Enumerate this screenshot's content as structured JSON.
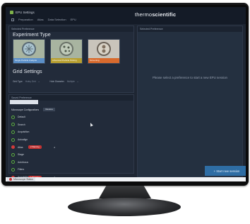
{
  "app": {
    "title": "EPU Settings",
    "brand_light": "thermo",
    "brand_bold": "scientific"
  },
  "menu": [
    "Preparation",
    "Atlas",
    "Data Selection",
    "EPU"
  ],
  "left_top": {
    "header": "Selected Preference",
    "experiment_type_title": "Experiment Type",
    "cards": [
      {
        "label": "Single Particle Analysis",
        "color": "#5b8fc8"
      },
      {
        "label": "Advanced Particle Picking",
        "color": "#b8a030"
      },
      {
        "label": "Screening",
        "color": "#d86a2d"
      }
    ],
    "grid_settings_title": "Grid Settings",
    "grid_type_label": "Grid Type",
    "grid_type_value": "Holey Grid",
    "hole_type_label": "Hole Diameter",
    "hole_type_value": "Multiple"
  },
  "left_bot": {
    "header": "Saved Preference",
    "categories_title": "Microscope Configurations",
    "restore_label": "Restore",
    "items": [
      {
        "label": "Default",
        "state": "green",
        "pill": "",
        "count": ""
      },
      {
        "label": "Search",
        "state": "green",
        "pill": "",
        "count": ""
      },
      {
        "label": "Acquisition",
        "state": "green",
        "pill": "",
        "count": ""
      },
      {
        "label": "Autoalign",
        "state": "green",
        "pill": "",
        "count": ""
      },
      {
        "label": "Atlas",
        "state": "red",
        "pill": "2 Warning",
        "count": "2"
      },
      {
        "label": "Stage",
        "state": "green",
        "pill": "",
        "count": ""
      },
      {
        "label": "Autofocus",
        "state": "green",
        "pill": "",
        "count": ""
      },
      {
        "label": "Filters",
        "state": "green",
        "pill": "",
        "count": ""
      },
      {
        "label": "Acquisition",
        "state": "red",
        "pill": "1 Warning",
        "count": "1"
      }
    ]
  },
  "right": {
    "header": "Selected Preference",
    "placeholder": "Please select a preference to start a new EPU session",
    "start_button": "Start new session"
  },
  "taskbar": {
    "tab_label": "Microscope Status"
  }
}
